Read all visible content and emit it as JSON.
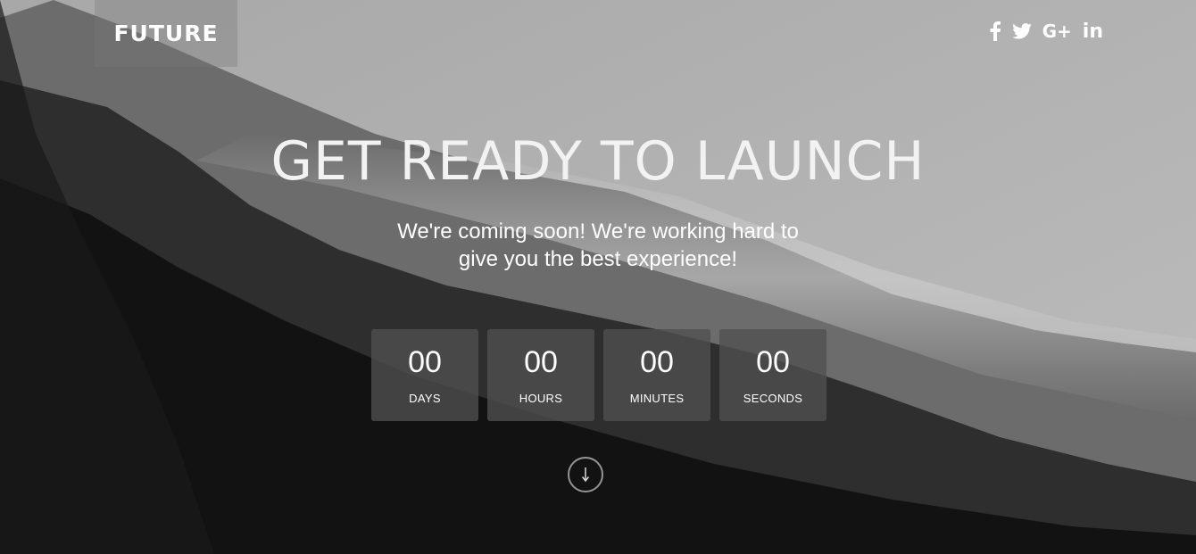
{
  "brand": {
    "logo": "FUTURE"
  },
  "social": [
    {
      "icon": "facebook-icon",
      "label": "f"
    },
    {
      "icon": "twitter-icon",
      "label": ""
    },
    {
      "icon": "google-plus-icon",
      "label": "G+"
    },
    {
      "icon": "linkedin-icon",
      "label": "in"
    }
  ],
  "hero": {
    "title": "GET READY TO LAUNCH",
    "subtitle_line1": "We're coming soon! We're working hard to",
    "subtitle_line2": "give you the best experience!"
  },
  "countdown": [
    {
      "value": "00",
      "label": "DAYS"
    },
    {
      "value": "00",
      "label": "HOURS"
    },
    {
      "value": "00",
      "label": "MINUTES"
    },
    {
      "value": "00",
      "label": "SECONDS"
    }
  ],
  "scroll": {
    "icon": "arrow-down-icon"
  }
}
